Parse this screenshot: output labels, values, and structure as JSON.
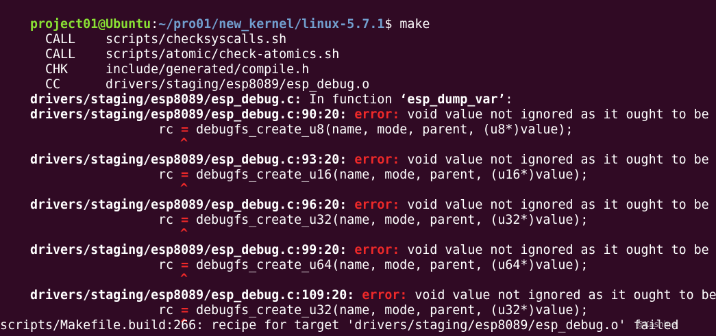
{
  "prompt": {
    "user_host": "project01@Ubuntu",
    "separator": ":",
    "path": "~/pro01/new_kernel/linux-5.7.1",
    "suffix": "$ ",
    "command": "make"
  },
  "build_steps": [
    {
      "tag": "CALL",
      "target": "scripts/checksyscalls.sh"
    },
    {
      "tag": "CALL",
      "target": "scripts/atomic/check-atomics.sh"
    },
    {
      "tag": "CHK",
      "target": "include/generated/compile.h"
    },
    {
      "tag": "CC",
      "target": "drivers/staging/esp8089/esp_debug.o"
    }
  ],
  "function_note": {
    "file": "drivers/staging/esp8089/esp_debug.c:",
    "text_before": " In function ",
    "func": "‘esp_dump_var’",
    "text_after": ":"
  },
  "errors": [
    {
      "location": "drivers/staging/esp8089/esp_debug.c:90:20:",
      "label": "error:",
      "message": " void value not ignored as it ought to be",
      "code_pre": "rc ",
      "code_eq": "=",
      "code_post": " debugfs_create_u8(name, mode, parent, (u8*)value);",
      "caret": "^"
    },
    {
      "location": "drivers/staging/esp8089/esp_debug.c:93:20:",
      "label": "error:",
      "message": " void value not ignored as it ought to be",
      "code_pre": "rc ",
      "code_eq": "=",
      "code_post": " debugfs_create_u16(name, mode, parent, (u16*)value);",
      "caret": "^"
    },
    {
      "location": "drivers/staging/esp8089/esp_debug.c:96:20:",
      "label": "error:",
      "message": " void value not ignored as it ought to be",
      "code_pre": "rc ",
      "code_eq": "=",
      "code_post": " debugfs_create_u32(name, mode, parent, (u32*)value);",
      "caret": "^"
    },
    {
      "location": "drivers/staging/esp8089/esp_debug.c:99:20:",
      "label": "error:",
      "message": " void value not ignored as it ought to be",
      "code_pre": "rc ",
      "code_eq": "=",
      "code_post": " debugfs_create_u64(name, mode, parent, (u64*)value);",
      "caret": "^"
    },
    {
      "location": "drivers/staging/esp8089/esp_debug.c:109:20:",
      "label": "error:",
      "message": " void value not ignored as it ought to be",
      "code_pre": "rc ",
      "code_eq": "=",
      "code_post": " debugfs_create_u32(name, mode, parent, (u32*)value);",
      "caret": "^"
    }
  ],
  "makefile_line": "scripts/Makefile.build:266: recipe for target 'drivers/staging/esp8089/esp_debug.o' failed",
  "watermark": "@Kashine",
  "colors": {
    "background": "#300a24",
    "prompt_user": "#8ae234",
    "prompt_path": "#729fcf",
    "error": "#ef2929",
    "text": "#ffffff"
  }
}
